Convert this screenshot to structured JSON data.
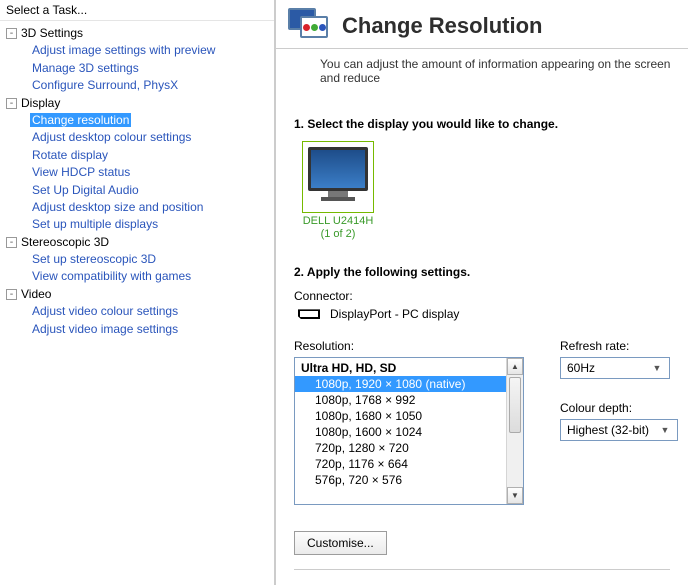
{
  "sidebar": {
    "header": "Select a Task...",
    "groups": [
      {
        "label": "3D Settings",
        "children": [
          "Adjust image settings with preview",
          "Manage 3D settings",
          "Configure Surround, PhysX"
        ]
      },
      {
        "label": "Display",
        "children": [
          "Change resolution",
          "Adjust desktop colour settings",
          "Rotate display",
          "View HDCP status",
          "Set Up Digital Audio",
          "Adjust desktop size and position",
          "Set up multiple displays"
        ],
        "selectedIndex": 0
      },
      {
        "label": "Stereoscopic 3D",
        "children": [
          "Set up stereoscopic 3D",
          "View compatibility with games"
        ]
      },
      {
        "label": "Video",
        "children": [
          "Adjust video colour settings",
          "Adjust video image settings"
        ]
      }
    ]
  },
  "page": {
    "title": "Change Resolution",
    "description": "You can adjust the amount of information appearing on the screen and reduce",
    "step1": "1. Select the display you would like to change.",
    "step2": "2. Apply the following settings.",
    "monitor_name": "DELL U2414H",
    "monitor_index": "(1 of 2)",
    "connector_label": "Connector:",
    "connector_value": "DisplayPort - PC display",
    "resolution_label": "Resolution:",
    "res_group": "Ultra HD, HD, SD",
    "res_items": [
      "1080p, 1920 × 1080 (native)",
      "1080p, 1768 × 992",
      "1080p, 1680 × 1050",
      "1080p, 1600 × 1024",
      "720p, 1280 × 720",
      "720p, 1176 × 664",
      "576p, 720 × 576"
    ],
    "res_selected": 0,
    "refresh_label": "Refresh rate:",
    "refresh_value": "60Hz",
    "depth_label": "Colour depth:",
    "depth_value": "Highest (32-bit)",
    "customise_label": "Customise..."
  }
}
